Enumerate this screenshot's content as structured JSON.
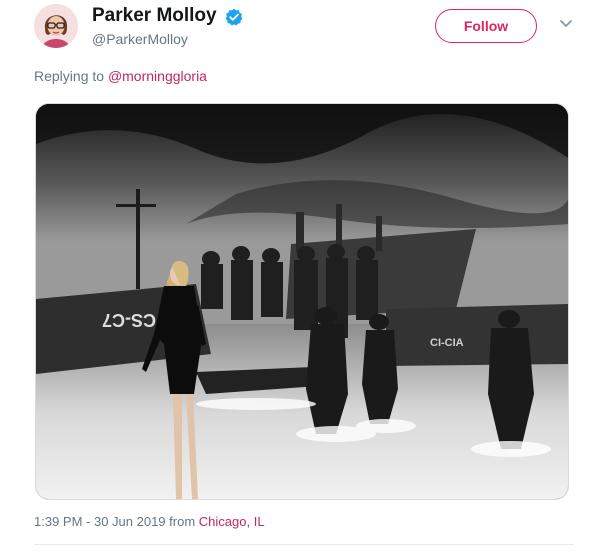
{
  "tweet": {
    "author_name": "Parker Molloy",
    "author_handle": "@ParkerMolloy",
    "follow_label": "Follow",
    "reply_prefix": "Replying to",
    "reply_to": "@morninggloria",
    "time_text": "1:39 PM - 30 Jun 2019 from",
    "location": "Chicago, IL"
  },
  "photo": {
    "hull_text_left": "CS-C7",
    "hull_text_right": "CI-CIA"
  },
  "colors": {
    "accent": "#e0245e",
    "link": "#c02763",
    "verified": "#1da1f2",
    "muted": "#657786"
  },
  "icons": {
    "verified": "verified-badge-icon",
    "caret": "chevron-down-icon"
  }
}
